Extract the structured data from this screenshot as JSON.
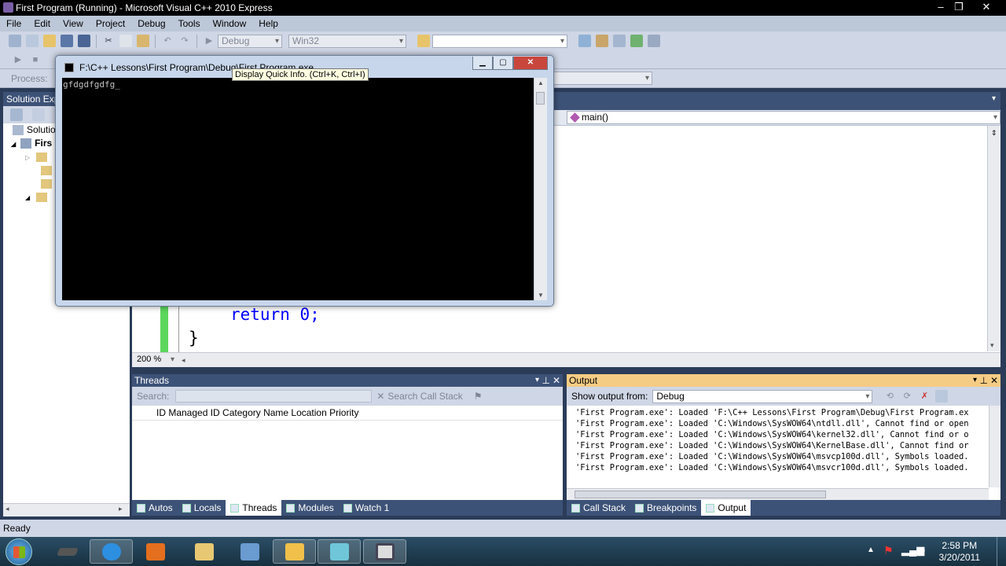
{
  "window": {
    "title": "First Program (Running) - Microsoft Visual C++ 2010 Express"
  },
  "menu": [
    "File",
    "Edit",
    "View",
    "Project",
    "Debug",
    "Tools",
    "Window",
    "Help"
  ],
  "toolbar": {
    "config": "Debug",
    "platform": "Win32",
    "find_value": ""
  },
  "debug_toolbar": {
    "process_label": "Process:"
  },
  "solution_explorer": {
    "title": "Solution Exp",
    "solution_label": "Solutio",
    "project_label": "Firs"
  },
  "editor": {
    "member_combo": "main()",
    "zoom": "200 %",
    "code_line1": "return 0;",
    "code_line2": "}"
  },
  "console": {
    "title": "F:\\C++ Lessons\\First Program\\Debug\\First Program.exe",
    "text": "gfdgdfgdfg_"
  },
  "tooltip": {
    "text": "Display Quick Info. (Ctrl+K, Ctrl+I)"
  },
  "threads": {
    "title": "Threads",
    "search_label": "Search:",
    "search_call_stack": "Search Call Stack",
    "columns": "ID  Managed ID  Category  Name  Location  Priority"
  },
  "output": {
    "title": "Output",
    "show_from_label": "Show output from:",
    "show_from_value": "Debug",
    "lines": [
      "'First Program.exe': Loaded 'F:\\C++ Lessons\\First Program\\Debug\\First Program.ex",
      "'First Program.exe': Loaded 'C:\\Windows\\SysWOW64\\ntdll.dll', Cannot find or open",
      "'First Program.exe': Loaded 'C:\\Windows\\SysWOW64\\kernel32.dll', Cannot find or o",
      "'First Program.exe': Loaded 'C:\\Windows\\SysWOW64\\KernelBase.dll', Cannot find or",
      "'First Program.exe': Loaded 'C:\\Windows\\SysWOW64\\msvcp100d.dll', Symbols loaded.",
      "'First Program.exe': Loaded 'C:\\Windows\\SysWOW64\\msvcr100d.dll', Symbols loaded."
    ]
  },
  "left_tabs": [
    "Autos",
    "Locals",
    "Threads",
    "Modules",
    "Watch 1"
  ],
  "right_tabs": [
    "Call Stack",
    "Breakpoints",
    "Output"
  ],
  "status": {
    "text": "Ready"
  },
  "clock": {
    "time": "2:58 PM",
    "date": "3/20/2011"
  },
  "colors": {
    "titlebar": "#000000",
    "toolwindow_header": "#3d5277",
    "output_header": "#f5cc84",
    "console_bg": "#000000",
    "accent_green": "#5cd65c"
  }
}
